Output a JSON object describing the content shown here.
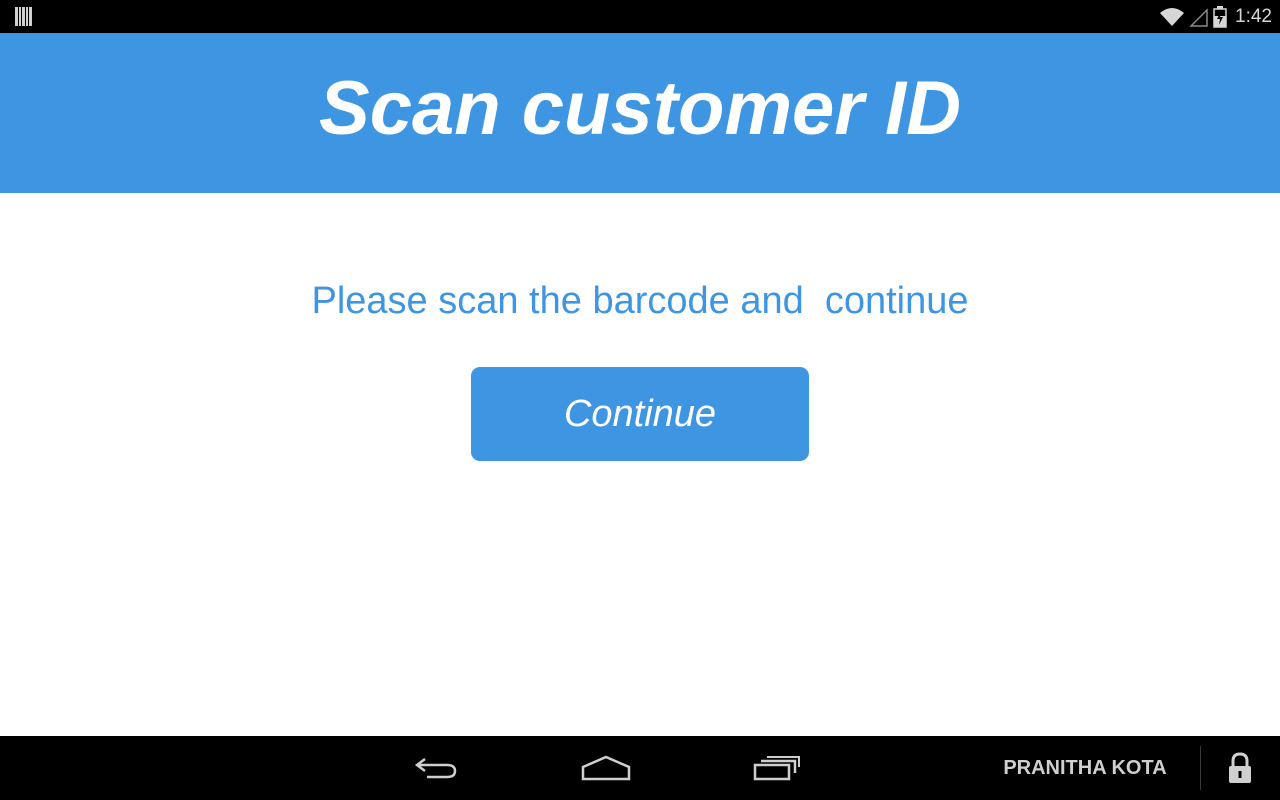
{
  "status_bar": {
    "time": "1:42",
    "icons": [
      "barcode-icon",
      "wifi-icon",
      "signal-icon",
      "battery-icon"
    ]
  },
  "header": {
    "title": "Scan customer ID",
    "background_color": "#3e96e2"
  },
  "main": {
    "prompt": "Please scan the barcode and  continue",
    "continue_label": "Continue",
    "accent_color": "#3e96e2"
  },
  "nav_bar": {
    "buttons": [
      "back-icon",
      "home-icon",
      "recent-apps-icon"
    ],
    "user_name": "PRANITHA KOTA",
    "lock_icon": "lock-icon"
  }
}
